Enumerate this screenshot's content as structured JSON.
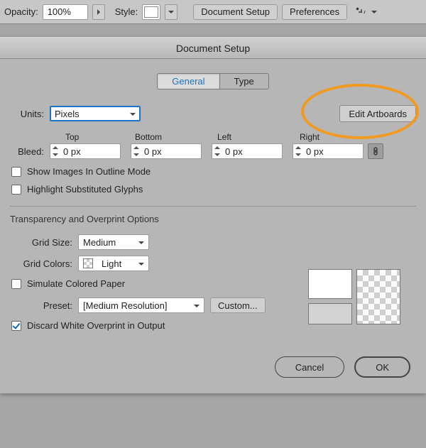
{
  "topbar": {
    "opacity_label": "Opacity:",
    "opacity_value": "100%",
    "style_label": "Style:",
    "doc_setup_btn": "Document Setup",
    "prefs_btn": "Preferences"
  },
  "dialog": {
    "title": "Document Setup",
    "tabs": {
      "general": "General",
      "type": "Type"
    },
    "units_label": "Units:",
    "units_value": "Pixels",
    "edit_artboards": "Edit Artboards",
    "bleed": {
      "label": "Bleed:",
      "headers": {
        "top": "Top",
        "bottom": "Bottom",
        "left": "Left",
        "right": "Right"
      },
      "values": {
        "top": "0 px",
        "bottom": "0 px",
        "left": "0 px",
        "right": "0 px"
      }
    },
    "show_images_outline": "Show Images In Outline Mode",
    "highlight_sub_glyphs": "Highlight Substituted Glyphs",
    "transparency_section": "Transparency and Overprint Options",
    "grid_size_label": "Grid Size:",
    "grid_size_value": "Medium",
    "grid_colors_label": "Grid Colors:",
    "grid_colors_value": "Light",
    "simulate_paper": "Simulate Colored Paper",
    "preset_label": "Preset:",
    "preset_value": "[Medium Resolution]",
    "custom_btn": "Custom...",
    "discard_white": "Discard White Overprint in Output",
    "checked_discard": true,
    "cancel": "Cancel",
    "ok": "OK"
  }
}
